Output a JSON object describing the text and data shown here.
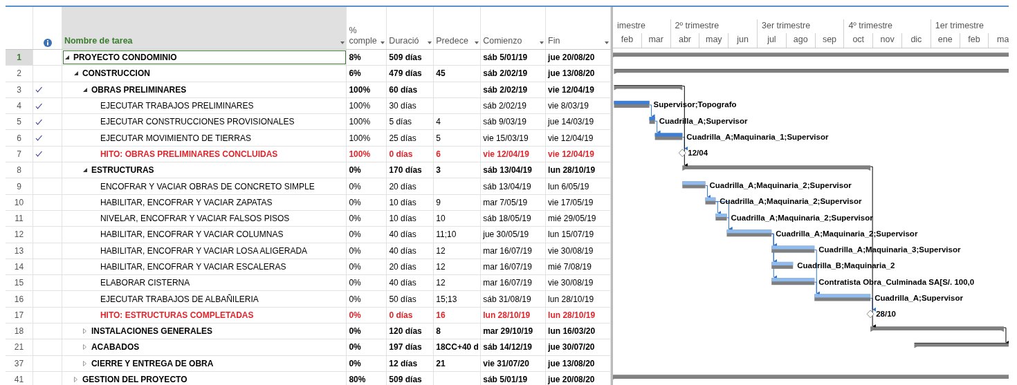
{
  "columns": [
    {
      "label": "Nombre de tarea"
    },
    {
      "label": "% comple"
    },
    {
      "label": "Duració"
    },
    {
      "label": "Predece"
    },
    {
      "label": "Comienzo"
    },
    {
      "label": "Fin"
    }
  ],
  "timescale": {
    "quarters": [
      {
        "label": "imestre"
      },
      {
        "label": "2º trimestre"
      },
      {
        "label": "3er trimestre"
      },
      {
        "label": "4º trimestre"
      },
      {
        "label": "1er trimestre"
      }
    ],
    "months": [
      "feb",
      "mar",
      "abr",
      "may",
      "jun",
      "jul",
      "ago",
      "sep",
      "oct",
      "nov",
      "dic",
      "ene",
      "feb",
      "ma"
    ]
  },
  "tasks": [
    {
      "id": "1",
      "name": "PROYECTO CONDOMINIO",
      "pct": "8%",
      "duration": "509 días",
      "start": "sáb 5/01/19",
      "finish": "jue 20/08/20",
      "kind": "summary",
      "done": false,
      "selected": true,
      "expanded": true,
      "children": [
        {
          "id": "2",
          "name": "CONSTRUCCION",
          "pct": "6%",
          "duration": "479 días",
          "predecessors": "45",
          "start": "sáb 2/02/19",
          "finish": "jue 13/08/20",
          "kind": "summary",
          "done": false,
          "selected": false,
          "expanded": true,
          "children": [
            {
              "id": "3",
              "name": "OBRAS PRELIMINARES",
              "pct": "100%",
              "duration": "60 días",
              "start": "sáb 2/02/19",
              "finish": "vie 12/04/19",
              "kind": "summary",
              "done": true,
              "selected": false,
              "expanded": true,
              "children": [
                {
                  "id": "4",
                  "name": "EJECUTAR TRABAJOS PRELIMINARES",
                  "pct": "100%",
                  "duration": "30 días",
                  "start": "sáb 2/02/19",
                  "finish": "vie 8/03/19",
                  "kind": "task",
                  "done": true,
                  "selected": false,
                  "bar_label": "Supervisor;Topografo"
                },
                {
                  "id": "5",
                  "name": "EJECUTAR CONSTRUCCIONES PROVISIONALES",
                  "pct": "100%",
                  "duration": "5 días",
                  "predecessors": "4",
                  "start": "sáb 9/03/19",
                  "finish": "jue 14/03/19",
                  "kind": "task",
                  "done": true,
                  "selected": false,
                  "bar_label": "Cuadrilla_A;Supervisor"
                },
                {
                  "id": "6",
                  "name": "EJECUTAR MOVIMIENTO DE TIERRAS",
                  "pct": "100%",
                  "duration": "25 días",
                  "predecessors": "5",
                  "start": "vie 15/03/19",
                  "finish": "vie 12/04/19",
                  "kind": "task",
                  "done": true,
                  "selected": false,
                  "bar_label": "Cuadrilla_A;Maquinaria_1;Supervisor"
                },
                {
                  "id": "7",
                  "name": "HITO: OBRAS PRELIMINARES CONCLUIDAS",
                  "pct": "100%",
                  "duration": "0 días",
                  "predecessors": "6",
                  "start": "vie 12/04/19",
                  "finish": "vie 12/04/19",
                  "kind": "milestone",
                  "done": true,
                  "selected": false,
                  "bar_label": "12/04"
                }
              ]
            },
            {
              "id": "8",
              "name": "ESTRUCTURAS",
              "pct": "0%",
              "duration": "170 días",
              "predecessors": "3",
              "start": "sáb 13/04/19",
              "finish": "lun 28/10/19",
              "kind": "summary",
              "done": false,
              "selected": false,
              "expanded": true,
              "children": [
                {
                  "id": "9",
                  "name": "ENCOFRAR Y VACIAR OBRAS DE CONCRETO SIMPLE",
                  "pct": "0%",
                  "duration": "20 días",
                  "start": "sáb 13/04/19",
                  "finish": "lun 6/05/19",
                  "kind": "task",
                  "done": false,
                  "selected": false,
                  "bar_label": "Cuadrilla_A;Maquinaria_2;Supervisor"
                },
                {
                  "id": "10",
                  "name": "HABILITAR, ENCOFRAR Y VACIAR ZAPATAS",
                  "pct": "0%",
                  "duration": "10 días",
                  "predecessors": "9",
                  "start": "mar 7/05/19",
                  "finish": "vie 17/05/19",
                  "kind": "task",
                  "done": false,
                  "selected": false,
                  "bar_label": "Cuadrilla_A;Maquinaria_2;Supervisor"
                },
                {
                  "id": "11",
                  "name": "NIVELAR, ENCOFRAR Y VACIAR FALSOS PISOS",
                  "pct": "0%",
                  "duration": "10 días",
                  "predecessors": "10",
                  "start": "sáb 18/05/19",
                  "finish": "mié 29/05/19",
                  "kind": "task",
                  "done": false,
                  "selected": false,
                  "bar_label": "Cuadrilla_A;Maquinaria_2;Supervisor"
                },
                {
                  "id": "12",
                  "name": "HABILITAR, ENCOFRAR Y VACIAR COLUMNAS",
                  "pct": "0%",
                  "duration": "40 días",
                  "predecessors": "11;10",
                  "start": "jue 30/05/19",
                  "finish": "lun 15/07/19",
                  "kind": "task",
                  "done": false,
                  "selected": false,
                  "bar_label": "Cuadrilla_A;Maquinaria_2;Supervisor"
                },
                {
                  "id": "13",
                  "name": "HABILITAR, ENCOFRAR Y VACIAR LOSA ALIGERADA",
                  "pct": "0%",
                  "duration": "40 días",
                  "predecessors": "12",
                  "start": "mar 16/07/19",
                  "finish": "vie 30/08/19",
                  "kind": "task",
                  "done": false,
                  "selected": false,
                  "bar_label": "Cuadrilla_A;Maquinaria_3;Supervisor"
                },
                {
                  "id": "14",
                  "name": "HABILITAR, ENCOFRAR Y VACIAR ESCALERAS",
                  "pct": "0%",
                  "duration": "20 días",
                  "predecessors": "12",
                  "start": "mar 16/07/19",
                  "finish": "mié 7/08/19",
                  "kind": "task",
                  "done": false,
                  "selected": false,
                  "bar_label": "Cuadrilla_B;Maquinaria_2"
                },
                {
                  "id": "15",
                  "name": "ELABORAR CISTERNA",
                  "pct": "0%",
                  "duration": "40 días",
                  "predecessors": "12",
                  "start": "mar 16/07/19",
                  "finish": "vie 30/08/19",
                  "kind": "task",
                  "done": false,
                  "selected": false,
                  "bar_label": "Contratista Obra_Culminada SA[S/. 100,0"
                },
                {
                  "id": "16",
                  "name": "EJECUTAR TRABAJOS DE ALBAÑILERIA",
                  "pct": "0%",
                  "duration": "50 días",
                  "predecessors": "15;13",
                  "start": "sáb 31/08/19",
                  "finish": "lun 28/10/19",
                  "kind": "task",
                  "done": false,
                  "selected": false,
                  "bar_label": "Cuadrilla_A;Supervisor"
                },
                {
                  "id": "17",
                  "name": "HITO: ESTRUCTURAS COMPLETADAS",
                  "pct": "0%",
                  "duration": "0 días",
                  "predecessors": "16",
                  "start": "lun 28/10/19",
                  "finish": "lun 28/10/19",
                  "kind": "milestone",
                  "done": false,
                  "selected": false,
                  "bar_label": "28/10"
                }
              ]
            },
            {
              "id": "18",
              "name": "INSTALACIONES GENERALES",
              "pct": "0%",
              "duration": "120 días",
              "predecessors": "8",
              "start": "mar 29/10/19",
              "finish": "lun 16/03/20",
              "kind": "summary",
              "done": false,
              "selected": false,
              "expanded": false
            },
            {
              "id": "21",
              "name": "ACABADOS",
              "pct": "0%",
              "duration": "197 días",
              "predecessors": "18CC+40 d",
              "start": "sáb 14/12/19",
              "finish": "jue 30/07/20",
              "kind": "summary",
              "done": false,
              "selected": false,
              "expanded": false
            },
            {
              "id": "37",
              "name": "CIERRE Y ENTREGA DE OBRA",
              "pct": "0%",
              "duration": "12 días",
              "predecessors": "21",
              "start": "vie 31/07/20",
              "finish": "jue 13/08/20",
              "kind": "summary",
              "done": false,
              "selected": false,
              "expanded": false
            }
          ]
        },
        {
          "id": "41",
          "name": "GESTION DEL PROYECTO",
          "pct": "80%",
          "duration": "509 días",
          "start": "sáb 5/01/19",
          "finish": "jue 20/08/20",
          "kind": "summary",
          "done": false,
          "selected": false,
          "expanded": false
        }
      ]
    }
  ]
}
